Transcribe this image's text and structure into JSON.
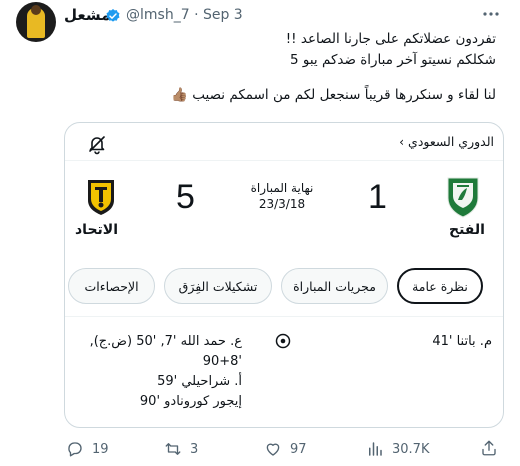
{
  "author": {
    "name": "مشعل",
    "handle": "@lmsh_7",
    "date": "· Sep 3",
    "verified": true
  },
  "tweet": {
    "lines": [
      "تفردون عضلاتكم على جارنا الصاعد !!",
      "شكلكم نسيتو آخر مباراة ضدكم يبو 5",
      "لنا لقاء و سنكررها قريباً سنجعل لكم من اسمكم نصيب 👍🏽"
    ]
  },
  "match": {
    "league": "الدوري السعودي",
    "league_chevron": "›",
    "home_team": "الفتح",
    "home_score": "1",
    "away_team": "الاتحاد",
    "away_score": "5",
    "status": "نهاية المباراة",
    "date": "23/3/18",
    "tabs": [
      {
        "label": "نظرة عامة",
        "active": true
      },
      {
        "label": "مجريات المباراة",
        "active": false
      },
      {
        "label": "تشكيلات الفِرَق",
        "active": false
      },
      {
        "label": "الإحصاءات",
        "active": false
      }
    ],
    "home_scorers": [
      "م. باتنا '41"
    ],
    "away_scorers": [
      "ع. حمد الله '7, '50 (ض.ج),",
      "'90+8",
      "أ. شراحيلي '59",
      "إيجور كورونادو '90"
    ]
  },
  "actions": {
    "replies": "19",
    "reposts": "3",
    "likes": "97",
    "views": "30.7K"
  },
  "colors": {
    "text": "#0f1419",
    "secondary": "#536471",
    "border": "#cfd9de",
    "verified": "#1d9bf0",
    "fateh_green": "#1f7a3a",
    "ittihad_yellow": "#f2c200"
  }
}
